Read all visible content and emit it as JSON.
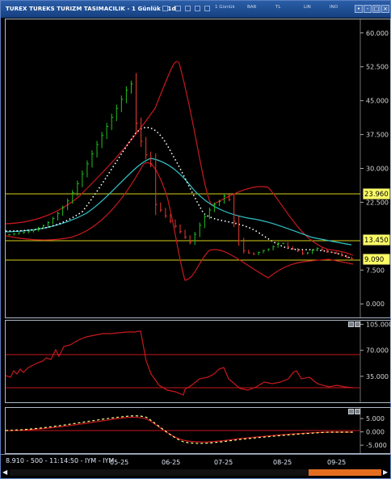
{
  "window": {
    "title": "TUREX TUREKS TURIZM TASIMACILIK - 1 Günlük (.1d)",
    "toolbar": {
      "interval": "1 Günlük",
      "chart_type": "BAR",
      "currency": "TL",
      "scale": "LIN",
      "indicator": "INO"
    }
  },
  "status": {
    "text": "8.910 - 500 - 11:14:50 - IYM - IYM"
  },
  "colors": {
    "background": "#000000",
    "price_up": "#22c21e",
    "price_down": "#e83b32",
    "bands": "#c8191d",
    "moving_avg": "#ffffff",
    "ma_long": "#31c3c8",
    "horizontal_levels": "#d7d01b",
    "price_tag_bg": "#fdfd66",
    "oscillator_lines": "#c8191d",
    "macd_signal": "#ffff88",
    "scroll_thumb": "#e46e1f"
  },
  "chart_data": [
    {
      "type": "line",
      "panel": "price",
      "x_tick_labels": [
        "05-25",
        "06-25",
        "07-25",
        "08-25",
        "09-25"
      ],
      "ylim": [
        -3,
        63
      ],
      "y_ticks": [
        "60.000",
        "52.500",
        "45.000",
        "37.500",
        "30.000",
        "22.500",
        "7.500",
        "0.000"
      ],
      "y_tick_values": [
        60,
        52.5,
        45,
        37.5,
        30,
        22.5,
        7.5,
        0
      ],
      "levels": [
        {
          "label": "23.960",
          "value": 23.96
        },
        {
          "label": "13.450",
          "value": 13.45
        },
        {
          "label": "9.090",
          "value": 9.09
        }
      ],
      "series": [
        {
          "values_close": [
            15.3,
            15.5,
            15.7,
            15.8,
            16.0,
            16.3,
            16.8,
            17.3,
            18.0,
            18.9,
            20.0,
            21.3,
            22.8,
            24.6,
            26.6,
            28.8,
            31.0,
            33.2,
            35.3,
            37.3,
            39.3,
            41.3,
            43.3,
            45.3,
            47.3,
            48.7,
            40.0,
            36.0,
            33.0,
            31.0,
            22.0,
            20.8,
            19.5,
            18.3,
            17.2,
            16.0,
            14.8,
            13.6,
            15.4,
            17.4,
            19.3,
            20.8,
            22.0,
            22.7,
            23.9,
            23.1,
            18.3,
            14.0,
            11.8,
            11.3,
            11.0,
            11.4,
            11.8,
            12.1,
            12.7,
            13.4,
            13.4,
            12.6,
            12.2,
            11.7,
            11.1,
            11.3,
            11.9,
            12.3,
            12.0,
            11.5,
            11.4,
            11.2,
            10.7,
            10.3,
            10.0
          ]
        }
      ]
    },
    {
      "type": "line",
      "panel": "rsi",
      "ylim": [
        0,
        110
      ],
      "y_ticks": [
        "105.000",
        "70.000",
        "35.000"
      ],
      "y_tick_values": [
        105,
        70,
        35
      ],
      "levels": [
        70,
        30
      ]
    },
    {
      "type": "line",
      "panel": "macd",
      "ylim": [
        -8,
        9
      ],
      "y_ticks": [
        "5.000",
        "0.000",
        "-5.000"
      ],
      "y_tick_values": [
        5,
        0,
        -5
      ],
      "levels": [
        0
      ]
    }
  ]
}
